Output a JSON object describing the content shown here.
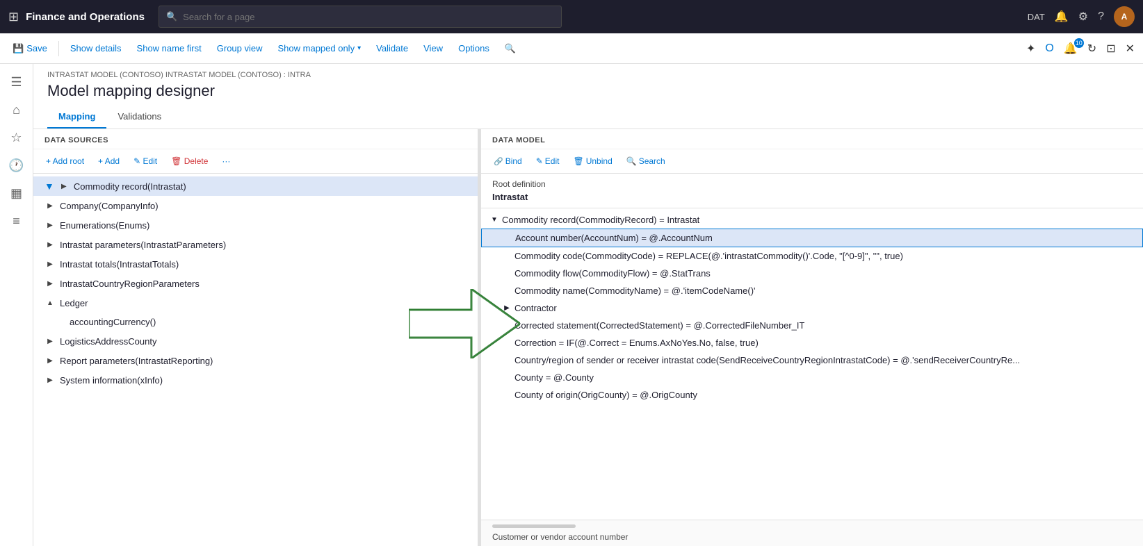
{
  "topNav": {
    "appTitle": "Finance and Operations",
    "searchPlaceholder": "Search for a page",
    "envBadge": "DAT",
    "gridIcon": "⊞",
    "bellIcon": "🔔",
    "gearIcon": "⚙",
    "helpIcon": "?",
    "avatarInitials": "A"
  },
  "cmdBar": {
    "saveLabel": "Save",
    "showDetailsLabel": "Show details",
    "showNameFirstLabel": "Show name first",
    "groupViewLabel": "Group view",
    "showMappedOnlyLabel": "Show mapped only",
    "validateLabel": "Validate",
    "viewLabel": "View",
    "optionsLabel": "Options"
  },
  "breadcrumb": "INTRASTAT MODEL (CONTOSO) INTRASTAT MODEL (CONTOSO) : INTRA",
  "pageTitle": "Model mapping designer",
  "tabs": [
    {
      "label": "Mapping",
      "active": true
    },
    {
      "label": "Validations",
      "active": false
    }
  ],
  "leftPanel": {
    "header": "DATA SOURCES",
    "toolbar": {
      "addRootLabel": "+ Add root",
      "addLabel": "+ Add",
      "editLabel": "✎ Edit",
      "deleteLabel": "🗑 Delete",
      "moreLabel": "···"
    },
    "items": [
      {
        "label": "Commodity record(Intrastat)",
        "indent": 0,
        "expanded": false,
        "selected": true,
        "hasExpand": true
      },
      {
        "label": "Company(CompanyInfo)",
        "indent": 0,
        "expanded": false,
        "selected": false,
        "hasExpand": true
      },
      {
        "label": "Enumerations(Enums)",
        "indent": 0,
        "expanded": false,
        "selected": false,
        "hasExpand": true
      },
      {
        "label": "Intrastat parameters(IntrastatParameters)",
        "indent": 0,
        "expanded": false,
        "selected": false,
        "hasExpand": true
      },
      {
        "label": "Intrastat totals(IntrastatTotals)",
        "indent": 0,
        "expanded": false,
        "selected": false,
        "hasExpand": true
      },
      {
        "label": "IntrastatCountryRegionParameters",
        "indent": 0,
        "expanded": false,
        "selected": false,
        "hasExpand": true
      },
      {
        "label": "Ledger",
        "indent": 0,
        "expanded": true,
        "selected": false,
        "hasExpand": true
      },
      {
        "label": "accountingCurrency()",
        "indent": 1,
        "expanded": false,
        "selected": false,
        "hasExpand": false
      },
      {
        "label": "LogisticsAddressCounty",
        "indent": 0,
        "expanded": false,
        "selected": false,
        "hasExpand": true
      },
      {
        "label": "Report parameters(IntrastatReporting)",
        "indent": 0,
        "expanded": false,
        "selected": false,
        "hasExpand": true
      },
      {
        "label": "System information(xInfo)",
        "indent": 0,
        "expanded": false,
        "selected": false,
        "hasExpand": true
      }
    ]
  },
  "rightPanel": {
    "header": "DATA MODEL",
    "toolbar": {
      "bindLabel": "Bind",
      "editLabel": "Edit",
      "unbindLabel": "Unbind",
      "searchLabel": "Search"
    },
    "rootDefinitionLabel": "Root definition",
    "rootDefinitionValue": "Intrastat",
    "items": [
      {
        "label": "Commodity record(CommodityRecord) = Intrastat",
        "indent": 0,
        "expanded": true,
        "selected": false,
        "isParent": true
      },
      {
        "label": "Account number(AccountNum) = @.AccountNum",
        "indent": 1,
        "selected": true,
        "isParent": false
      },
      {
        "label": "Commodity code(CommodityCode) = REPLACE(@.'intrastatCommodity()'.Code, \"[^0-9]\", \"\", true)",
        "indent": 1,
        "selected": false
      },
      {
        "label": "Commodity flow(CommodityFlow) = @.StatTrans",
        "indent": 1,
        "selected": false
      },
      {
        "label": "Commodity name(CommodityName) = @.'itemCodeName()'",
        "indent": 1,
        "selected": false
      },
      {
        "label": "Contractor",
        "indent": 1,
        "selected": false,
        "isParent": true,
        "hasExpand": true
      },
      {
        "label": "Corrected statement(CorrectedStatement) = @.CorrectedFileNumber_IT",
        "indent": 1,
        "selected": false
      },
      {
        "label": "Correction = IF(@.Correct = Enums.AxNoYes.No, false, true)",
        "indent": 1,
        "selected": false
      },
      {
        "label": "Country/region of sender or receiver intrastat code(SendReceiveCountryRegionIntrastatCode) = @.'sendReceiverCountryRe...",
        "indent": 1,
        "selected": false
      },
      {
        "label": "County = @.County",
        "indent": 1,
        "selected": false
      },
      {
        "label": "County of origin(OrigCounty) = @.OrigCounty",
        "indent": 1,
        "selected": false
      }
    ],
    "bottomLabel": "Customer or vendor account number"
  }
}
